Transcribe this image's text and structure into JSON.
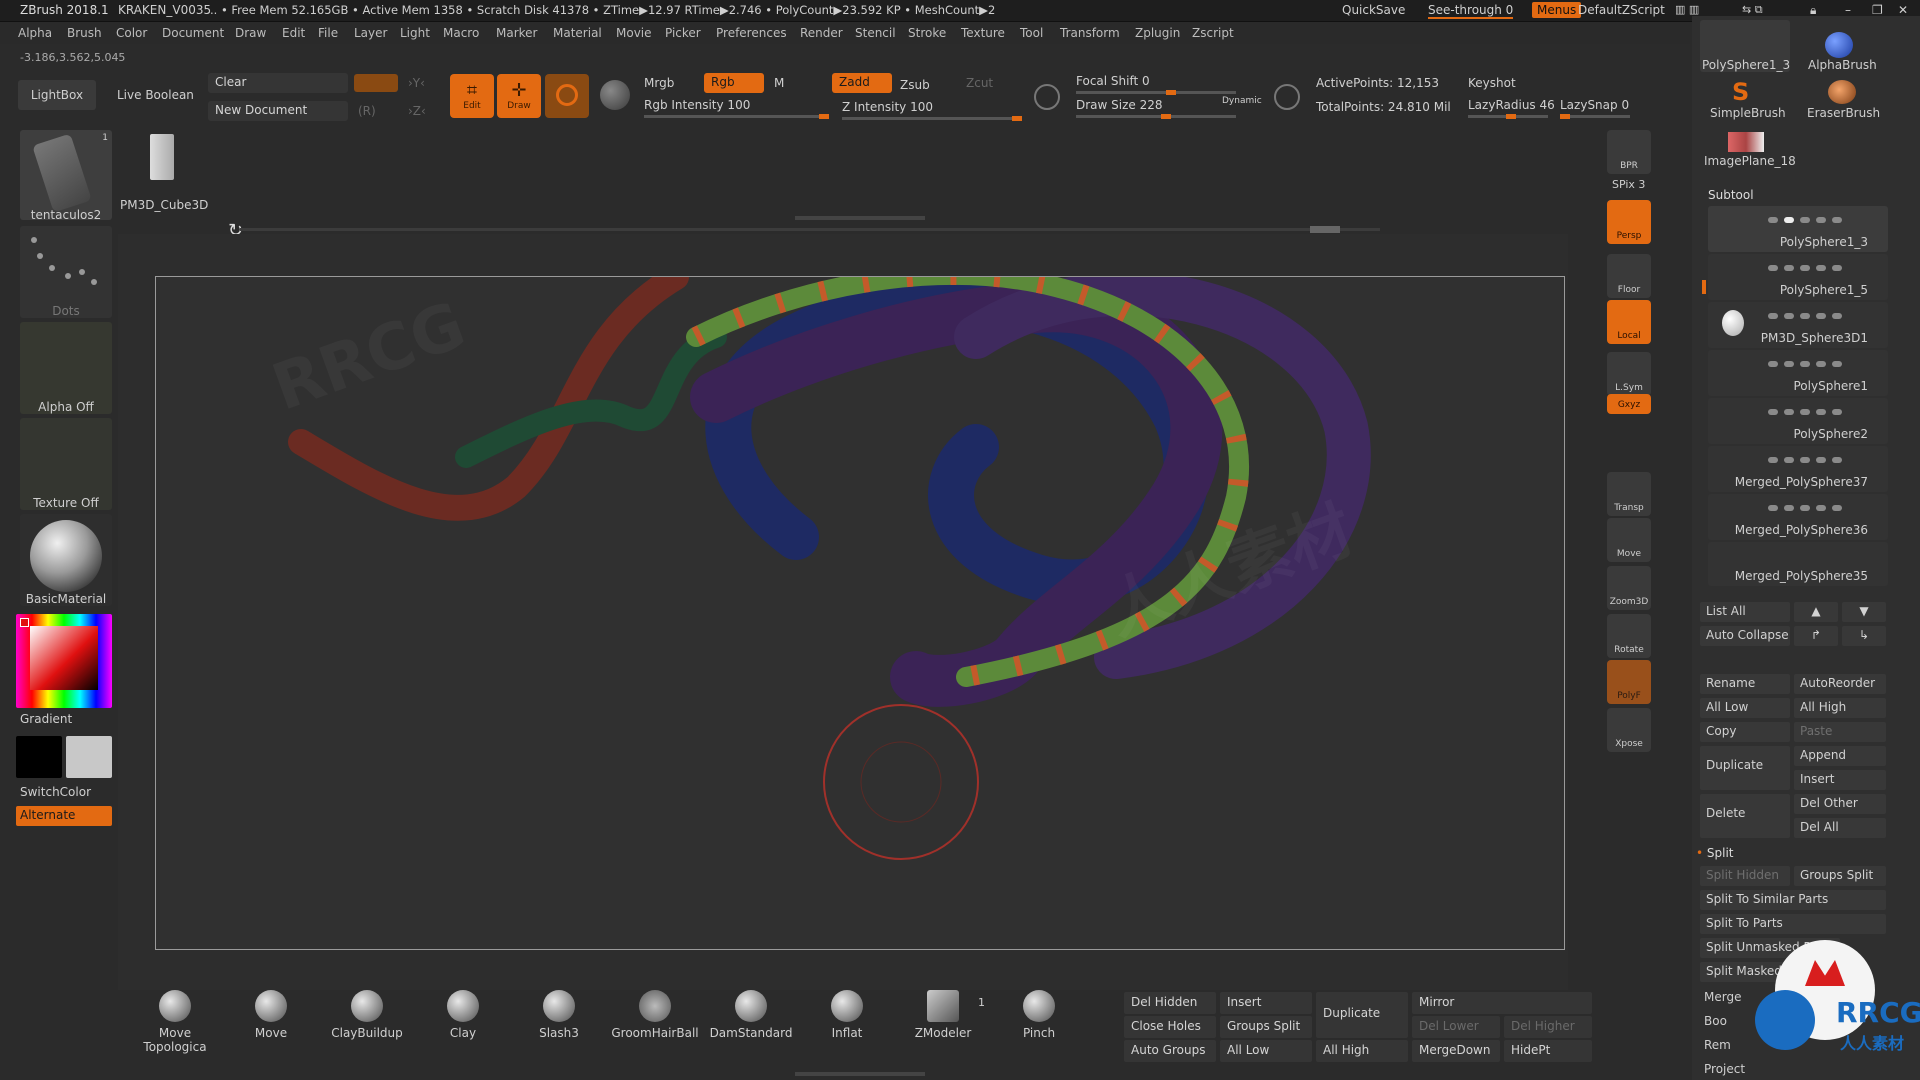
{
  "titlebar": {
    "app": "ZBrush 2018.1",
    "project": "KRAKEN_V0035",
    "stats": ".. • Free Mem 52.165GB • Active Mem 1358 • Scratch Disk 41378 • ZTime▶12.97 RTime▶2.746 • PolyCount▶23.592 KP • MeshCount▶2",
    "quicksave": "QuickSave",
    "seethrough": "See-through  0",
    "menus": "Menus",
    "script": "DefaultZScript"
  },
  "menubar": [
    "Alpha",
    "Brush",
    "Color",
    "Document",
    "Draw",
    "Edit",
    "File",
    "Layer",
    "Light",
    "Macro",
    "Marker",
    "Material",
    "Movie",
    "Picker",
    "Preferences",
    "Render",
    "Stencil",
    "Stroke",
    "Texture",
    "Tool",
    "Transform",
    "Zplugin",
    "Zscript"
  ],
  "coords": "-3.186,3.562,5.045",
  "toolbar": {
    "lightbox": "LightBox",
    "liveboolean": "Live Boolean",
    "clear": "Clear",
    "newdoc": "New Document",
    "r_key": "(R)",
    "edit": "Edit",
    "draw": "Draw",
    "mrgb": "Mrgb",
    "rgb": "Rgb",
    "m": "M",
    "rgb_intensity": "Rgb Intensity 100",
    "zadd": "Zadd",
    "zsub": "Zsub",
    "zcut": "Zcut",
    "z_intensity": "Z Intensity 100",
    "focal_shift": "Focal Shift 0",
    "draw_size": "Draw Size 228",
    "dynamic": "Dynamic",
    "active_points": "ActivePoints: 12,153",
    "total_points": "TotalPoints: 24.810 Mil",
    "keyshot": "Keyshot",
    "lazy_radius": "LazyRadius 46",
    "lazy_snap": "LazySnap 0"
  },
  "tool_thumbs": {
    "current": "tentaculos2",
    "current_count": "1",
    "second": "PM3D_Cube3D"
  },
  "left_shelf": {
    "dots": "Dots",
    "alpha": "Alpha Off",
    "texture": "Texture Off",
    "material": "BasicMaterial",
    "gradient": "Gradient",
    "switchcolor": "SwitchColor",
    "alternate": "Alternate"
  },
  "right_shelf": {
    "bpr": "BPR",
    "spix": "SPix 3",
    "persp": "Persp",
    "floor": "Floor",
    "local": "Local",
    "lsym": "L.Sym",
    "xyz": "Gxyz",
    "transp": "Transp",
    "move": "Move",
    "zoom3d": "Zoom3D",
    "rotate": "Rotate",
    "polyf": "PolyF",
    "xpose": "Xpose"
  },
  "brushes_top": [
    {
      "label": "PolySphere1_3"
    },
    {
      "label": "AlphaBrush"
    },
    {
      "label": "SimpleBrush"
    },
    {
      "label": "EraserBrush"
    },
    {
      "label": "ImagePlane_18"
    }
  ],
  "subtool": {
    "title": "Subtool",
    "items": [
      "PolySphere1_3",
      "PolySphere1_5",
      "PM3D_Sphere3D1",
      "PolySphere1",
      "PolySphere2",
      "Merged_PolySphere37",
      "Merged_PolySphere36",
      "Merged_PolySphere35"
    ],
    "list_all": "List All",
    "auto_collapse": "Auto Collapse",
    "rename": "Rename",
    "autoreorder": "AutoReorder",
    "all_low": "All Low",
    "all_high": "All High",
    "copy": "Copy",
    "paste": "Paste",
    "duplicate": "Duplicate",
    "append": "Append",
    "insert": "Insert",
    "delete": "Delete",
    "del_other": "Del Other",
    "del_all": "Del All",
    "split": "Split",
    "split_hidden": "Split Hidden",
    "groups_split": "Groups Split",
    "split_similar": "Split To Similar Parts",
    "split_parts": "Split To Parts",
    "split_unmasked": "Split Unmasked P",
    "split_masked": "Split Masked P",
    "merge": "Merge",
    "boolean": "Boo",
    "remesh": "Rem",
    "project": "Project"
  },
  "bottom_brushes": [
    "Move Topologica",
    "Move",
    "ClayBuildup",
    "Clay",
    "Slash3",
    "GroomHairBall",
    "DamStandard",
    "Inflat",
    "ZModeler",
    "Pinch"
  ],
  "zmodeler_count": "1",
  "bottom_buttons": {
    "del_hidden": "Del Hidden",
    "insert": "Insert",
    "duplicate": "Duplicate",
    "mirror": "Mirror",
    "close_holes": "Close Holes",
    "groups_split": "Groups Split",
    "del_lower": "Del Lower",
    "del_higher": "Del Higher",
    "auto_groups": "Auto Groups",
    "all_low": "All Low",
    "all_high": "All High",
    "mergedown": "MergeDown",
    "hidept": "HidePt"
  },
  "watermark": "RRCG",
  "watermark_cn": "人人素材",
  "colors": {
    "accent": "#e36a12",
    "bg": "#2b2b2b",
    "panel": "#2f2f2f"
  }
}
